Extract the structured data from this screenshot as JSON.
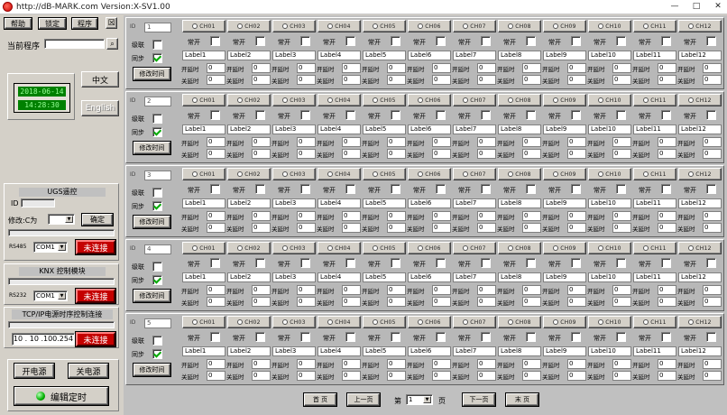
{
  "window": {
    "title": "http://dB-MARK.com  Version:X-SV1.00",
    "buttons": [
      "—",
      "□",
      "✕"
    ]
  },
  "left": {
    "toolbar": {
      "help": "帮助",
      "lock": "锁定",
      "program": "程序",
      "export": "☒"
    },
    "current_program_label": "当前程序",
    "clock": {
      "date": "2018-06-14",
      "time": "14:28:30"
    },
    "lang_cn": "中文",
    "lang_en": "English",
    "section1": {
      "title": "UGS遥控",
      "id_label": "ID",
      "select_label": "修改:C为",
      "confirm": "确定",
      "port_label": "RS485",
      "port_value": "COM1",
      "status": "未连接"
    },
    "section2": {
      "title": "KNX 控制模块",
      "port_label": "RS232",
      "port_value": "COM1",
      "status": "未连接"
    },
    "section3": {
      "title": "TCP/IP电源时序控制连接",
      "ip": "10 . 10 .100.254",
      "status": "未连接"
    },
    "power_on": "开电源",
    "power_off": "关电源",
    "edit_timing": "编辑定时"
  },
  "groups": [
    {
      "index": "1",
      "cascade": "级联",
      "sync": "同步",
      "edit": "修改时间",
      "channels": [
        "CH01",
        "CH02",
        "CH03",
        "CH04",
        "CH05",
        "CH06",
        "CH07",
        "CH08",
        "CH09",
        "CH10",
        "CH11",
        "CH12"
      ],
      "mode": [
        "常开",
        "常开",
        "常开",
        "常开",
        "常开",
        "常开",
        "常开",
        "常开",
        "常开",
        "常开",
        "常开",
        "常开"
      ],
      "labels": [
        "Label1",
        "Label2",
        "Label3",
        "Label4",
        "Label5",
        "Label6",
        "Label7",
        "Label8",
        "Label9",
        "Label10",
        "Label11",
        "Label12"
      ],
      "on_delay_label": "开延时",
      "off_delay_label": "关延时",
      "on_delay": "0",
      "off_delay": "0"
    },
    {
      "index": "2",
      "cascade": "级联",
      "sync": "同步",
      "edit": "修改时间",
      "channels": [
        "CH01",
        "CH02",
        "CH03",
        "CH04",
        "CH05",
        "CH06",
        "CH07",
        "CH08",
        "CH09",
        "CH10",
        "CH11",
        "CH12"
      ],
      "mode": [
        "常开",
        "常开",
        "常开",
        "常开",
        "常开",
        "常开",
        "常开",
        "常开",
        "常开",
        "常开",
        "常开",
        "常开"
      ],
      "labels": [
        "Label1",
        "Label2",
        "Label3",
        "Label4",
        "Label5",
        "Label6",
        "Label7",
        "Label8",
        "Label9",
        "Label10",
        "Label11",
        "Label12"
      ],
      "on_delay_label": "开延时",
      "off_delay_label": "关延时",
      "on_delay": "0",
      "off_delay": "0"
    },
    {
      "index": "3",
      "cascade": "级联",
      "sync": "同步",
      "edit": "修改时间",
      "channels": [
        "CH01",
        "CH02",
        "CH03",
        "CH04",
        "CH05",
        "CH06",
        "CH07",
        "CH08",
        "CH09",
        "CH10",
        "CH11",
        "CH12"
      ],
      "mode": [
        "常开",
        "常开",
        "常开",
        "常开",
        "常开",
        "常开",
        "常开",
        "常开",
        "常开",
        "常开",
        "常开",
        "常开"
      ],
      "labels": [
        "Label1",
        "Label2",
        "Label3",
        "Label4",
        "Label5",
        "Label6",
        "Label7",
        "Label8",
        "Label9",
        "Label10",
        "Label11",
        "Label12"
      ],
      "on_delay_label": "开延时",
      "off_delay_label": "关延时",
      "on_delay": "0",
      "off_delay": "0"
    },
    {
      "index": "4",
      "cascade": "级联",
      "sync": "同步",
      "edit": "修改时间",
      "channels": [
        "CH01",
        "CH02",
        "CH03",
        "CH04",
        "CH05",
        "CH06",
        "CH07",
        "CH08",
        "CH09",
        "CH10",
        "CH11",
        "CH12"
      ],
      "mode": [
        "常开",
        "常开",
        "常开",
        "常开",
        "常开",
        "常开",
        "常开",
        "常开",
        "常开",
        "常开",
        "常开",
        "常开"
      ],
      "labels": [
        "Label1",
        "Label2",
        "Label3",
        "Label4",
        "Label5",
        "Label6",
        "Label7",
        "Label8",
        "Label9",
        "Label10",
        "Label11",
        "Label12"
      ],
      "on_delay_label": "开延时",
      "off_delay_label": "关延时",
      "on_delay": "0",
      "off_delay": "0"
    },
    {
      "index": "5",
      "cascade": "级联",
      "sync": "同步",
      "edit": "修改时间",
      "channels": [
        "CH01",
        "CH02",
        "CH03",
        "CH04",
        "CH05",
        "CH06",
        "CH07",
        "CH08",
        "CH09",
        "CH10",
        "CH11",
        "CH12"
      ],
      "mode": [
        "常开",
        "常开",
        "常开",
        "常开",
        "常开",
        "常开",
        "常开",
        "常开",
        "常开",
        "常开",
        "常开",
        "常开"
      ],
      "labels": [
        "Label1",
        "Label2",
        "Label3",
        "Label4",
        "Label5",
        "Label6",
        "Label7",
        "Label8",
        "Label9",
        "Label10",
        "Label11",
        "Label12"
      ],
      "on_delay_label": "开延时",
      "off_delay_label": "关延时",
      "on_delay": "0",
      "off_delay": "0"
    }
  ],
  "pager": {
    "first": "首 页",
    "prev": "上一页",
    "page_prefix": "第",
    "page_value": "1",
    "page_suffix": "页",
    "next": "下一页",
    "last": "末 页"
  }
}
